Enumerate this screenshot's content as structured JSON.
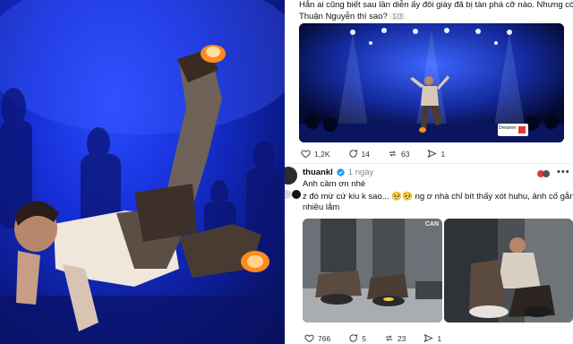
{
  "post1": {
    "text_line1": "Hẳn ai cũng biết sau lần diễn ấy đôi giày đã bị tàn phá cỡ nào. Nhưng còn anh tải",
    "text_line2": "Thuận Nguyễn thì sao?",
    "counter": "1/3",
    "actions": {
      "likes": "1,2K",
      "comments": "14",
      "reposts": "63",
      "shares": "1"
    },
    "video_logo_label": "Dreamer"
  },
  "reply": {
    "username": "thuankl",
    "verified": true,
    "time": "1 ngày",
    "text": "Anh cảm ơn nhé"
  },
  "post2": {
    "text_line1": "z đó mừ cứ kiu k sao... 🥺🥺 ng ơ nhà chỉ bít thấy xót huhu, ảnh cố gắng",
    "text_line2": "nhiều lắm",
    "actions": {
      "likes": "766",
      "comments": "5",
      "reposts": "23",
      "shares": "1"
    },
    "watermark": "CAN"
  },
  "icons": [
    "heart-icon",
    "comment-icon",
    "repost-icon",
    "share-icon",
    "verified-icon",
    "more-icon"
  ],
  "colors": {
    "stage_blue": "#1630d8",
    "verified": "#1d9bf0",
    "flame": "#ff8a1f"
  }
}
